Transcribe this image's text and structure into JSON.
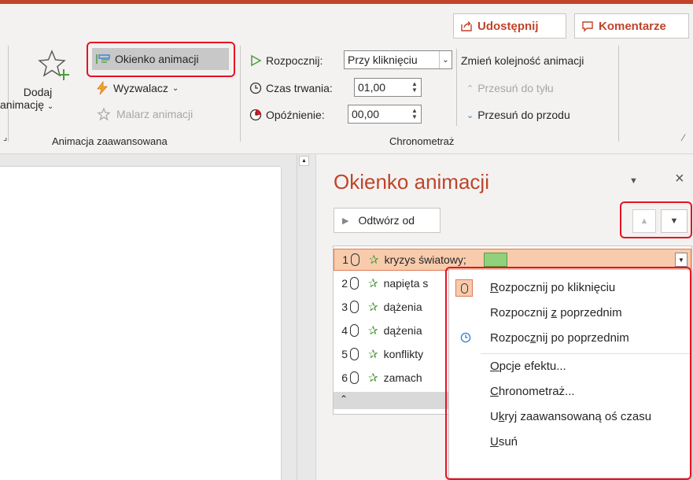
{
  "header": {
    "share_label": "Udostępnij",
    "comments_label": "Komentarze"
  },
  "ribbon": {
    "advanced": {
      "add_animation_line1": "Dodaj",
      "add_animation_line2": "animację",
      "animation_pane_label": "Okienko animacji",
      "trigger_label": "Wyzwalacz",
      "painter_label": "Malarz animacji",
      "group_label": "Animacja zaawansowana"
    },
    "timing": {
      "start_label": "Rozpocznij:",
      "start_value": "Przy kliknięciu",
      "duration_label": "Czas trwania:",
      "duration_value": "01,00",
      "delay_label": "Opóźnienie:",
      "delay_value": "00,00",
      "reorder_title": "Zmień kolejność animacji",
      "move_earlier": "Przesuń do tyłu",
      "move_later": "Przesuń do przodu",
      "group_label": "Chronometraż"
    }
  },
  "pane": {
    "title": "Okienko animacji",
    "play_label": "Odtwórz od",
    "items": [
      {
        "num": "1",
        "text": "kryzys światowy;"
      },
      {
        "num": "2",
        "text": "napięta s"
      },
      {
        "num": "3",
        "text": "dążenia"
      },
      {
        "num": "4",
        "text": "dążenia"
      },
      {
        "num": "5",
        "text": "konflikty"
      },
      {
        "num": "6",
        "text": "zamach"
      }
    ]
  },
  "context_menu": {
    "items": [
      {
        "before": "",
        "key": "R",
        "after": "ozpocznij po kliknięciu"
      },
      {
        "before": "Rozpocznij ",
        "key": "z",
        "after": " poprzednim"
      },
      {
        "before": "Rozpoc",
        "key": "z",
        "after": "nij po poprzednim"
      },
      {
        "before": "",
        "key": "O",
        "after": "pcje efektu..."
      },
      {
        "before": "",
        "key": "C",
        "after": "hronometraż..."
      },
      {
        "before": "U",
        "key": "k",
        "after": "ryj zaawansowaną oś czasu"
      },
      {
        "before": "",
        "key": "U",
        "after": "suń"
      }
    ]
  },
  "colors": {
    "accent": "#c0442a",
    "highlight": "#e81123",
    "selected_row": "#f8cbad",
    "green_star": "#4f9a3c"
  }
}
